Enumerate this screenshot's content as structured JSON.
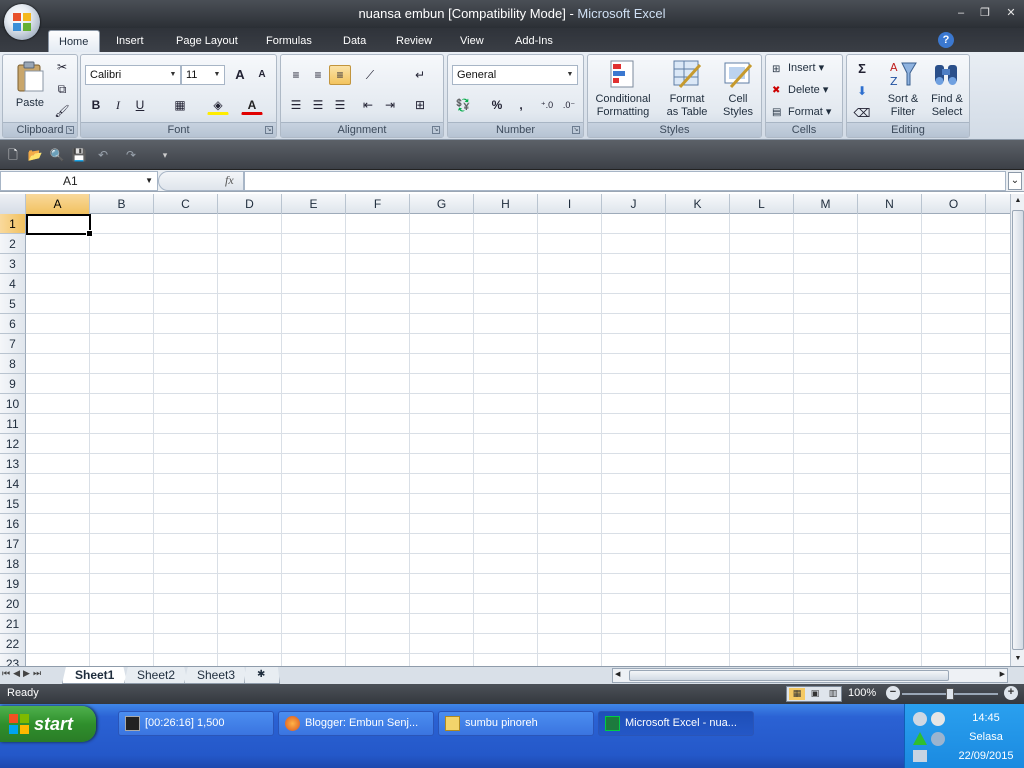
{
  "window": {
    "title_doc": "nuansa embun  [Compatibility Mode]",
    "title_sep": " - ",
    "title_app": "Microsoft Excel",
    "minimize": "–",
    "restore": "❐",
    "close": "✕"
  },
  "tabs": [
    "Home",
    "Insert",
    "Page Layout",
    "Formulas",
    "Data",
    "Review",
    "View",
    "Add-Ins"
  ],
  "ribbon": {
    "clipboard": {
      "label": "Clipboard",
      "paste": "Paste"
    },
    "font": {
      "label": "Font",
      "family": "Calibri",
      "size": "11",
      "bold": "B",
      "italic": "I",
      "underline": "U",
      "grow": "A",
      "shrink": "A"
    },
    "alignment": {
      "label": "Alignment"
    },
    "number": {
      "label": "Number",
      "format": "General",
      "percent": "%",
      "comma": ",",
      "inc_decimal": ".0→.00",
      "dec_decimal": ".00→.0"
    },
    "styles": {
      "label": "Styles",
      "conditional_1": "Conditional",
      "conditional_2": "Formatting",
      "format_table_1": "Format",
      "format_table_2": "as Table",
      "cell_styles_1": "Cell",
      "cell_styles_2": "Styles"
    },
    "cells": {
      "label": "Cells",
      "insert": "Insert",
      "delete": "Delete",
      "format": "Format"
    },
    "editing": {
      "label": "Editing",
      "sort_1": "Sort &",
      "sort_2": "Filter",
      "find_1": "Find &",
      "find_2": "Select",
      "sigma": "Σ"
    }
  },
  "formula_bar": {
    "name_box": "A1",
    "fx": "fx",
    "value": ""
  },
  "columns": [
    "A",
    "B",
    "C",
    "D",
    "E",
    "F",
    "G",
    "H",
    "I",
    "J",
    "K",
    "L",
    "M",
    "N",
    "O"
  ],
  "rows": [
    "1",
    "2",
    "3",
    "4",
    "5",
    "6",
    "7",
    "8",
    "9",
    "10",
    "11",
    "12",
    "13",
    "14",
    "15",
    "16",
    "17",
    "18",
    "19",
    "20",
    "21",
    "22",
    "23"
  ],
  "sheets": [
    "Sheet1",
    "Sheet2",
    "Sheet3"
  ],
  "status": {
    "text": "Ready",
    "zoom": "100%"
  },
  "taskbar": {
    "start": "start",
    "items": [
      {
        "label": "[00:26:16] 1,500"
      },
      {
        "label": "Blogger: Embun Senj..."
      },
      {
        "label": "sumbu pinoreh"
      },
      {
        "label": "Microsoft Excel - nua..."
      }
    ],
    "time": "14:45",
    "day": "Selasa",
    "date": "22/09/2015"
  },
  "colors": {
    "accent": "#f1c15f",
    "taskbar": "#2458c9",
    "start": "#2f8f2c"
  }
}
